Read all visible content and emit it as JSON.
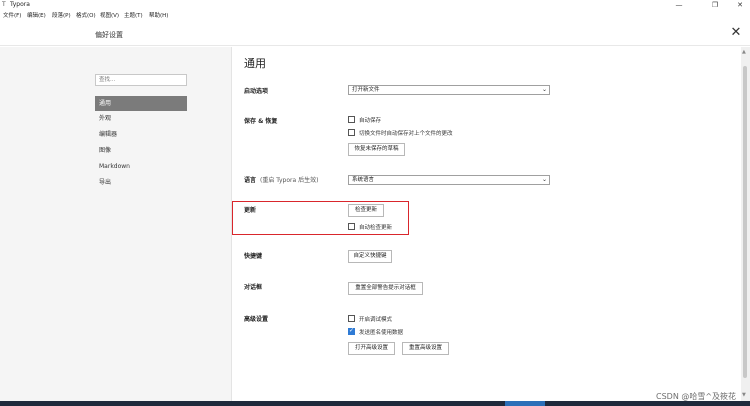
{
  "window": {
    "icon": "T",
    "title": "Typora",
    "minimize": "—",
    "restore": "❐",
    "close": "✕"
  },
  "menu": [
    {
      "label": "文件(F)"
    },
    {
      "label": "编辑(E)"
    },
    {
      "label": "段落(P)"
    },
    {
      "label": "格式(O)"
    },
    {
      "label": "视图(V)"
    },
    {
      "label": "主题(T)"
    },
    {
      "label": "帮助(H)"
    }
  ],
  "prefs": {
    "title": "偏好设置",
    "close": "✕"
  },
  "sidebar": {
    "search_placeholder": "查找...",
    "items": [
      {
        "label": "通用",
        "active": true
      },
      {
        "label": "外观",
        "active": false
      },
      {
        "label": "编辑器",
        "active": false
      },
      {
        "label": "图像",
        "active": false
      },
      {
        "label": "Markdown",
        "active": false
      },
      {
        "label": "导出",
        "active": false
      }
    ]
  },
  "main": {
    "section_title": "通用",
    "startup": {
      "label": "启动选项",
      "select_value": "打开新文件"
    },
    "save": {
      "label": "保存 & 恢复",
      "autosave_label": "自动保存",
      "autosave_checked": false,
      "keep_label": "切换文件时自动保存对上个文件的更改",
      "keep_checked": false,
      "recover_button": "恢复未保存的草稿"
    },
    "language": {
      "label": "语言",
      "hint": "(重启 Typora 后生效)",
      "select_value": "系统语言"
    },
    "update": {
      "label": "更新",
      "check_button": "检查更新",
      "auto_label": "自动检查更新",
      "auto_checked": false
    },
    "shortcut": {
      "label": "快捷键",
      "button": "自定义快捷键"
    },
    "dialog": {
      "label": "对话框",
      "button": "重置全部警告提示对话框"
    },
    "advanced": {
      "label": "高级设置",
      "debug_label": "开启调试模式",
      "debug_checked": false,
      "usage_label": "发送匿名使用数据",
      "usage_checked": true,
      "open_button": "打开高级设置",
      "reset_button": "重置高级设置"
    }
  },
  "watermark": "CSDN @哈雪^及筱花",
  "colors": {
    "highlight": "#d9262c",
    "active_nav": "#7b7b7b",
    "checkbox_checked": "#2f7bd5"
  }
}
